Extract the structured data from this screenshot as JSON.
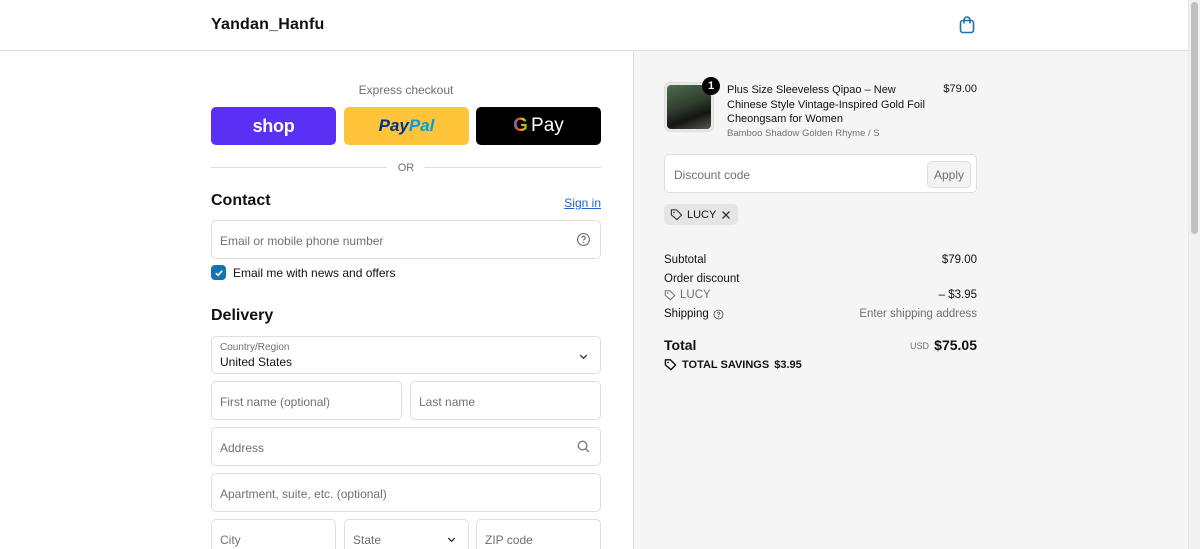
{
  "header": {
    "brand": "Yandan_Hanfu",
    "cart_icon": "shopping-bag-icon"
  },
  "express": {
    "title": "Express checkout",
    "shop_label": "shop",
    "paypal_label_1": "Pay",
    "paypal_label_2": "Pal",
    "gpay_g": "G",
    "gpay_label": "Pay",
    "or_label": "OR"
  },
  "contact": {
    "title": "Contact",
    "sign_in": "Sign in",
    "email_placeholder": "Email or mobile phone number",
    "newsletter_label": "Email me with news and offers",
    "newsletter_checked": true
  },
  "delivery": {
    "title": "Delivery",
    "country_label": "Country/Region",
    "country_value": "United States",
    "first_name_placeholder": "First name (optional)",
    "last_name_placeholder": "Last name",
    "address_placeholder": "Address",
    "apartment_placeholder": "Apartment, suite, etc. (optional)",
    "city_placeholder": "City",
    "state_placeholder": "State",
    "zip_placeholder": "ZIP code"
  },
  "cart": {
    "item": {
      "quantity": "1",
      "title": "Plus Size Sleeveless Qipao – New Chinese Style Vintage-Inspired Gold Foil Cheongsam for Women",
      "variant": "Bamboo Shadow Golden Rhyme / S",
      "price": "$79.00"
    },
    "discount_placeholder": "Discount code",
    "apply_label": "Apply",
    "applied_code": "LUCY"
  },
  "totals": {
    "subtotal_label": "Subtotal",
    "subtotal_value": "$79.00",
    "order_discount_label": "Order discount",
    "discount_code": "LUCY",
    "discount_value": "– $3.95",
    "shipping_label": "Shipping",
    "shipping_value": "Enter shipping address",
    "total_label": "Total",
    "total_currency": "USD",
    "total_value": "$75.05",
    "savings_label": "TOTAL SAVINGS",
    "savings_value": "$3.95"
  },
  "colors": {
    "shop": "#5a31f4",
    "paypal": "#ffc439",
    "link": "#1a63c9",
    "checkbox": "#1773b0",
    "panel": "#f5f5f5"
  }
}
